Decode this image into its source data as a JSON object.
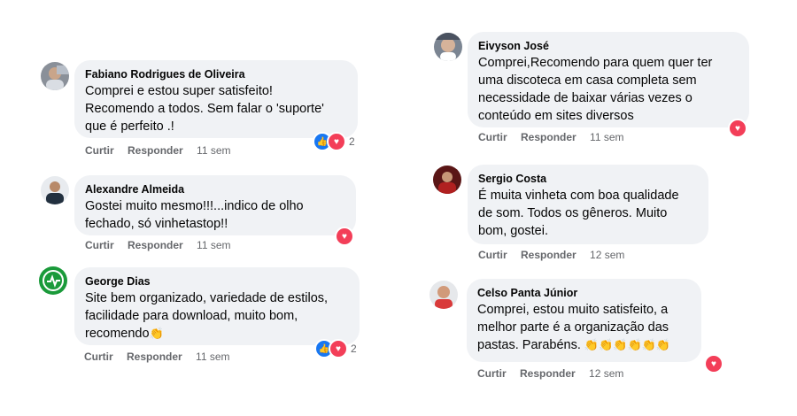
{
  "actions": {
    "like_label": "Curtir",
    "reply_label": "Responder"
  },
  "comments": [
    {
      "author": "Fabiano Rodrigues de Oliveira",
      "text": "Comprei e estou super satisfeito!\nRecomendo a todos. Sem falar o 'suporte'\nque é perfeito .!",
      "time": "11 sem",
      "reactions": [
        "like",
        "love"
      ],
      "reaction_count": "2"
    },
    {
      "author": "Alexandre Almeida",
      "text": "Gostei muito mesmo!!!...indico de olho\nfechado, só vinhetastop!!",
      "time": "11 sem",
      "reactions": [
        "love"
      ],
      "reaction_count": ""
    },
    {
      "author": "George Dias",
      "text": "Site bem organizado, variedade de estilos,\nfacilidade para download, muito bom,\nrecomendo",
      "time": "11 sem",
      "reactions": [
        "like",
        "love"
      ],
      "reaction_count": "2",
      "trailing_emoji": "clapping-hands"
    },
    {
      "author": "Eivyson José",
      "text": "Comprei,Recomendo para quem quer ter\numa discoteca em casa completa sem\nnecessidade de baixar várias vezes o\nconteúdo em sites diversos",
      "time": "11 sem",
      "reactions": [
        "love"
      ],
      "reaction_count": ""
    },
    {
      "author": "Sergio Costa",
      "text": "É muita vinheta com boa qualidade\nde som. Todos os gêneros. Muito\nbom, gostei.",
      "time": "12 sem",
      "reactions": [],
      "reaction_count": ""
    },
    {
      "author": "Celso Panta Júnior",
      "text": "Comprei, estou muito satisfeito, a\nmelhor parte é a organização das\npastas. Parabéns.",
      "time": "12 sem",
      "reactions": [
        "love"
      ],
      "reaction_count": "",
      "trailing_emoji": "clapping-hands x6"
    }
  ],
  "colors": {
    "bubble": "#f0f2f5",
    "like": "#1877f2",
    "love": "#f33e58",
    "meta": "#65676b"
  },
  "icons": {
    "like": "thumbs-up-icon",
    "love": "heart-icon",
    "clap": "clapping-hands-icon"
  }
}
